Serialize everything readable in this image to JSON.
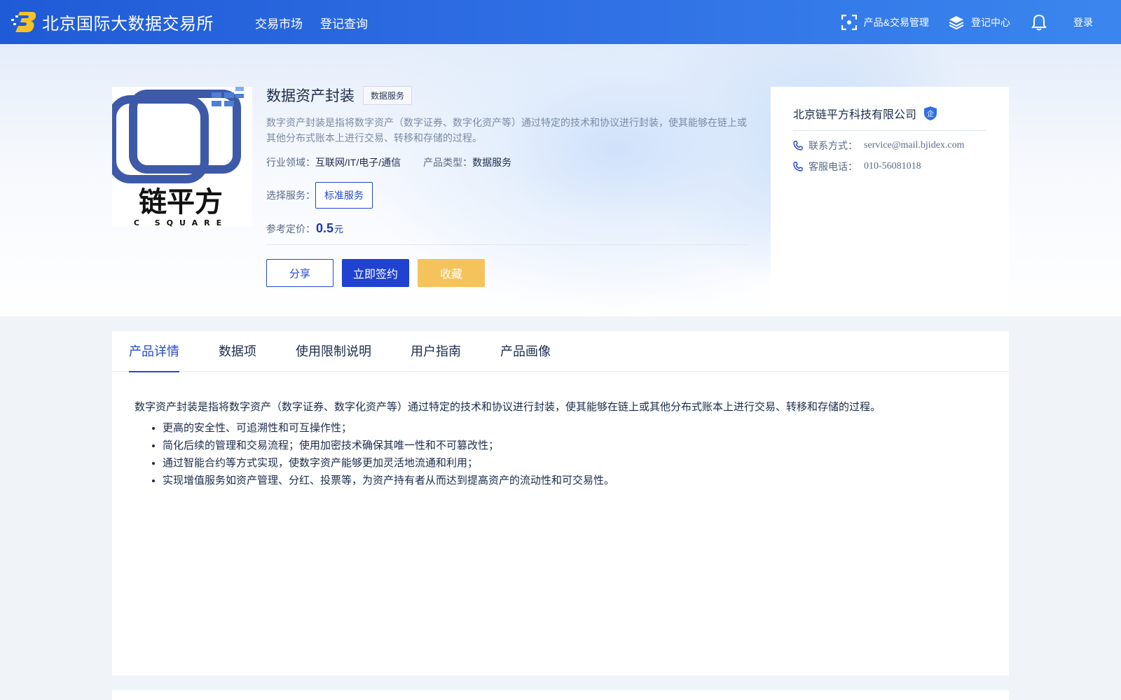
{
  "brand": {
    "title": "北京国际大数据交易所",
    "logo_icon": "exchange-logo-icon"
  },
  "nav": {
    "items": [
      "交易市场",
      "登记查询"
    ]
  },
  "top_right": {
    "product_mgmt": "产品&交易管理",
    "register_center": "登记中心",
    "login": "登录"
  },
  "product": {
    "logo_text": "链平方",
    "logo_subtext": "C SQUARE",
    "title": "数据资产封装",
    "tag": "数据服务",
    "description": "数字资产封装是指将数字资产（数字证券、数字化资产等）通过特定的技术和协议进行封装，使其能够在链上或其他分布式账本上进行交易、转移和存储的过程。",
    "industry_label": "行业领域：",
    "industry_value": "互联网/IT/电子/通信",
    "type_label": "产品类型：",
    "type_value": "数据服务",
    "service_label": "选择服务：",
    "service_option": "标准服务",
    "price_label": "参考定价：",
    "price_value": "0.5",
    "price_unit": "元",
    "buttons": {
      "share": "分享",
      "sign": "立即签约",
      "favorite": "收藏"
    }
  },
  "company": {
    "name": "北京链平方科技有限公司",
    "badge": "企",
    "contact_label": "联系方式：",
    "contact_value": "service@mail.bjidex.com",
    "phone_label": "客服电话：",
    "phone_value": "010-56081018"
  },
  "tabs": [
    "产品详情",
    "数据项",
    "使用限制说明",
    "用户指南",
    "产品画像"
  ],
  "active_tab": "产品详情",
  "detail": {
    "lead": "数字资产封装是指将数字资产（数字证券、数字化资产等）通过特定的技术和协议进行封装，使其能够在链上或其他分布式账本上进行交易、转移和存储的过程。",
    "bullets": [
      "更高的安全性、可追溯性和可互操作性；",
      "简化后续的管理和交易流程；使用加密技术确保其唯一性和不可篡改性；",
      "通过智能合约等方式实现，使数字资产能够更加灵活地流通和利用；",
      "实现增值服务如资产管理、分红、投票等，为资产持有者从而达到提高资产的流动性和可交易性。"
    ]
  },
  "colors": {
    "primary": "#2449c9",
    "topbar_start": "#1f5bd6",
    "topbar_end": "#3a86ee",
    "favorite": "#f5c35c"
  }
}
